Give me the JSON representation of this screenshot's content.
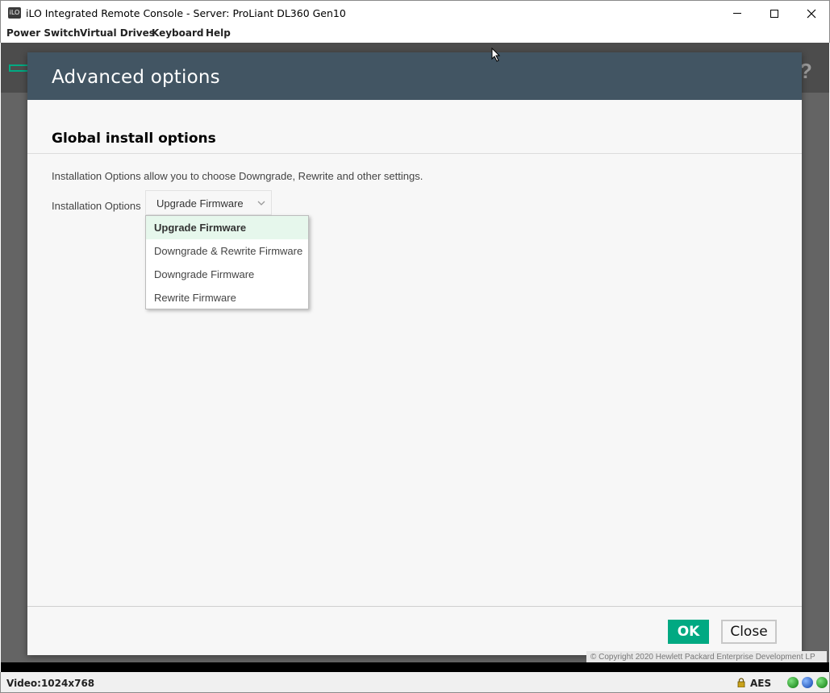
{
  "window": {
    "app_icon_text": "iLO",
    "title": "iLO Integrated Remote Console - Server: ProLiant DL360 Gen10"
  },
  "menu": [
    {
      "label": "Power Switch"
    },
    {
      "label": "Virtual Drives"
    },
    {
      "label": "Keyboard"
    },
    {
      "label": "Help"
    }
  ],
  "background": {
    "help_glyph": "?"
  },
  "modal": {
    "title": "Advanced options",
    "section_title": "Global install options",
    "description": "Installation Options allow you to choose Downgrade, Rewrite and other settings.",
    "field_label": "Installation Options",
    "select_value": "Upgrade Firmware",
    "options": [
      {
        "label": "Upgrade Firmware",
        "selected": true
      },
      {
        "label": "Downgrade & Rewrite Firmware",
        "selected": false
      },
      {
        "label": "Downgrade Firmware",
        "selected": false
      },
      {
        "label": "Rewrite Firmware",
        "selected": false
      }
    ],
    "ok_label": "OK",
    "close_label": "Close"
  },
  "copyright": "© Copyright 2020 Hewlett Packard Enterprise Development LP",
  "status": {
    "video": "Video:1024x768",
    "encryption": "AES"
  },
  "colors": {
    "accent": "#01a982",
    "header": "#425563",
    "selected_option_bg": "#e6f7ec"
  }
}
